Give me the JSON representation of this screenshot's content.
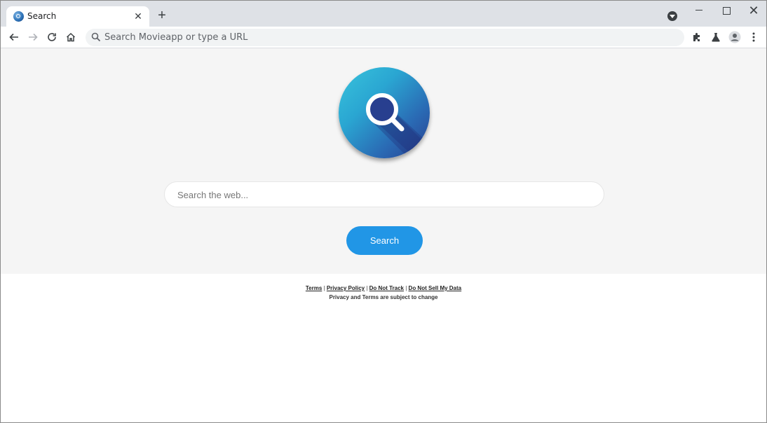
{
  "browser": {
    "tab_title": "Search",
    "tab_close": "✕",
    "new_tab": "+",
    "omnibox_placeholder": "Search Movieapp or type a URL",
    "icons": [
      "back-icon",
      "forward-icon",
      "reload-icon",
      "home-icon",
      "search-icon",
      "extensions-icon",
      "labs-icon",
      "profile-icon",
      "menu-icon"
    ],
    "window_close": "✕"
  },
  "page": {
    "search_placeholder": "Search the web...",
    "search_button": "Search",
    "footer": {
      "links": [
        "Terms",
        "Privacy Policy",
        "Do Not Track",
        "Do Not Sell My Data"
      ],
      "separator": "|",
      "note": "Privacy and Terms are subject to change"
    },
    "colors": {
      "accent": "#2196e6",
      "hero_bg": "#f5f5f5"
    }
  }
}
